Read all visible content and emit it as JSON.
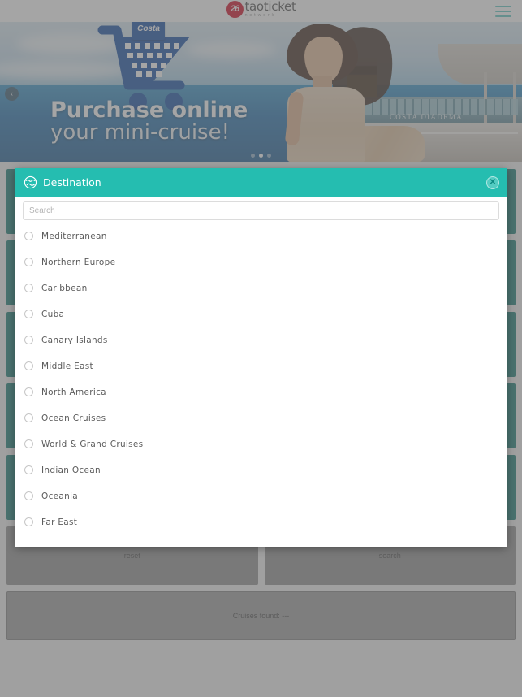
{
  "header": {
    "logo_badge": "26",
    "logo_main": "taoticket",
    "logo_sub": "network",
    "menu_icon": "hamburger-menu-icon"
  },
  "hero": {
    "brand_tag": "Costa",
    "title_line1": "Purchase online",
    "title_line2": "your mini-cruise!",
    "ship_name": "COSTA DIADEMA",
    "prev_arrow": "‹",
    "dots": [
      false,
      true,
      false
    ]
  },
  "modal": {
    "icon": "globe-icon",
    "title": "Destination",
    "close_label": "✕",
    "search": {
      "placeholder": "Search",
      "value": ""
    },
    "options": [
      {
        "label": "Mediterranean",
        "selected": false
      },
      {
        "label": "Northern Europe",
        "selected": false
      },
      {
        "label": "Caribbean",
        "selected": false
      },
      {
        "label": "Cuba",
        "selected": false
      },
      {
        "label": "Canary Islands",
        "selected": false
      },
      {
        "label": "Middle East",
        "selected": false
      },
      {
        "label": "North America",
        "selected": false
      },
      {
        "label": "Ocean Cruises",
        "selected": false
      },
      {
        "label": "World & Grand Cruises",
        "selected": false
      },
      {
        "label": "Indian Ocean",
        "selected": false
      },
      {
        "label": "Oceania",
        "selected": false
      },
      {
        "label": "Far East",
        "selected": false
      }
    ]
  },
  "form": {
    "reset_label": "reset",
    "search_label": "search",
    "result_text": "Cruises found: ---"
  },
  "colors": {
    "teal_header": "#25bdb0",
    "teal_field": "#0f766e",
    "brand_red": "#d0021b",
    "overlay": "#6e6e6e",
    "button_gray": "#8c8c8c"
  }
}
